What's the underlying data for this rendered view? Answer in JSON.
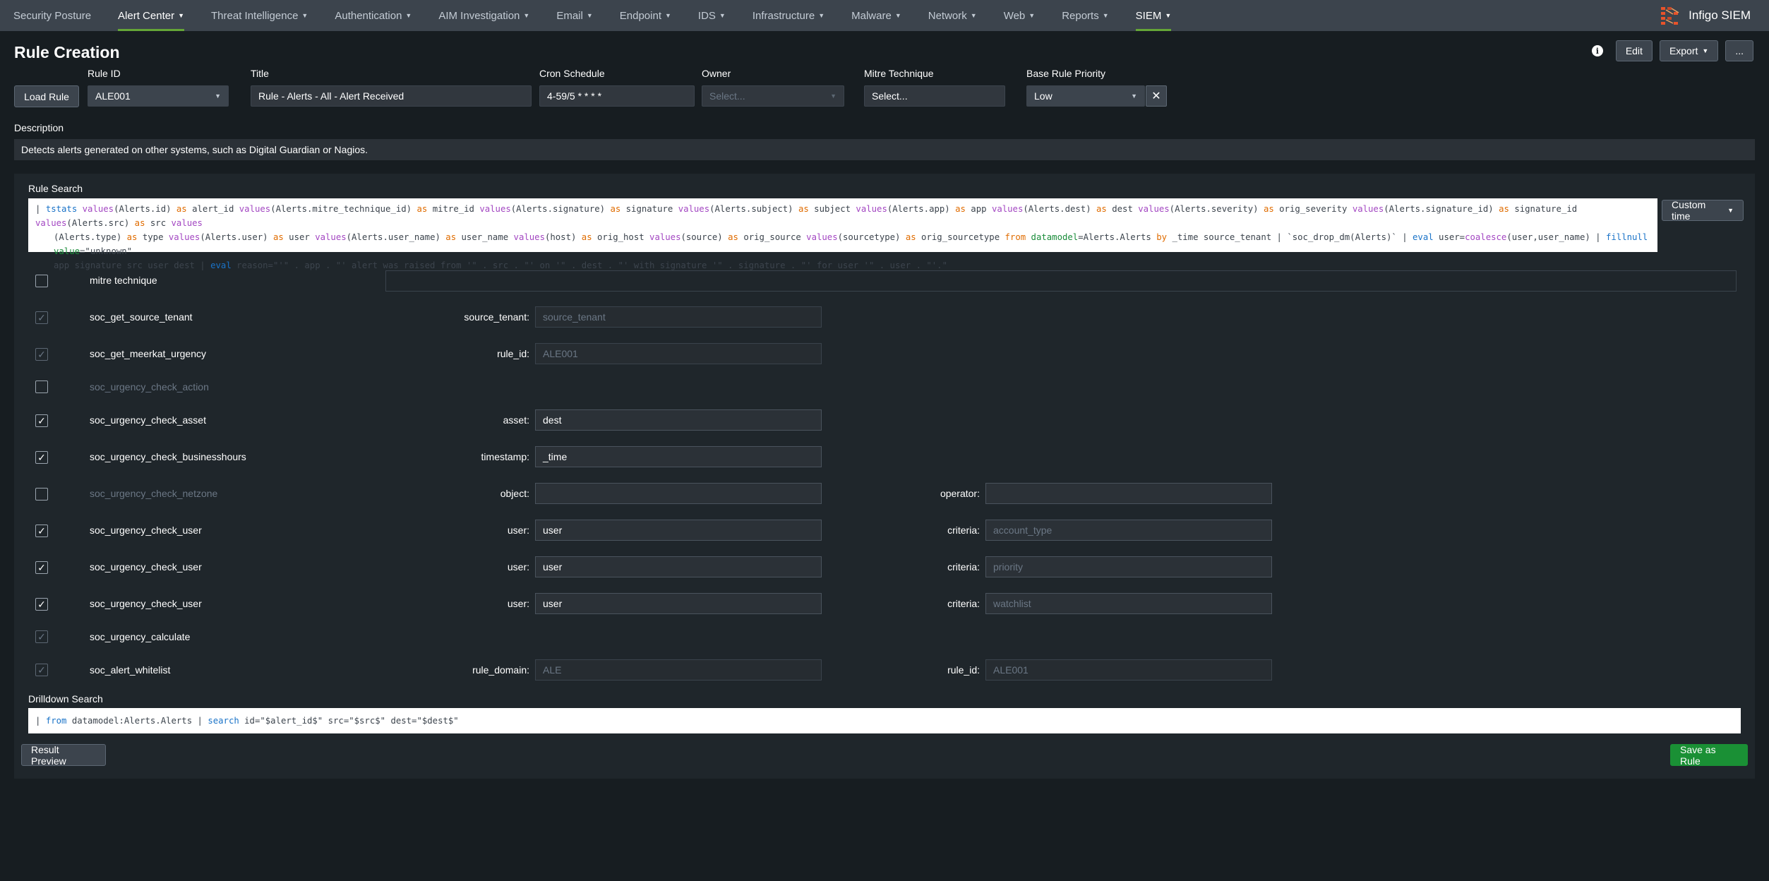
{
  "nav": {
    "items": [
      {
        "label": "Security Posture",
        "caret": false,
        "active": false
      },
      {
        "label": "Alert Center",
        "caret": true,
        "active": true
      },
      {
        "label": "Threat Intelligence",
        "caret": true,
        "active": false
      },
      {
        "label": "Authentication",
        "caret": true,
        "active": false
      },
      {
        "label": "AIM Investigation",
        "caret": true,
        "active": false
      },
      {
        "label": "Email",
        "caret": true,
        "active": false
      },
      {
        "label": "Endpoint",
        "caret": true,
        "active": false
      },
      {
        "label": "IDS",
        "caret": true,
        "active": false
      },
      {
        "label": "Infrastructure",
        "caret": true,
        "active": false
      },
      {
        "label": "Malware",
        "caret": true,
        "active": false
      },
      {
        "label": "Network",
        "caret": true,
        "active": false
      },
      {
        "label": "Web",
        "caret": true,
        "active": false
      },
      {
        "label": "Reports",
        "caret": true,
        "active": false
      },
      {
        "label": "SIEM",
        "caret": true,
        "active": true
      }
    ],
    "brand": "Infigo SIEM",
    "accent": "#65a637"
  },
  "page": {
    "title": "Rule Creation",
    "edit_label": "Edit",
    "export_label": "Export",
    "more_label": "..."
  },
  "form": {
    "load_rule_label": "Load Rule",
    "rule_id_label": "Rule ID",
    "rule_id_value": "ALE001",
    "title_label": "Title",
    "title_value": "Rule - Alerts - All - Alert Received",
    "cron_label": "Cron Schedule",
    "cron_value": "4-59/5 * * * *",
    "owner_label": "Owner",
    "owner_placeholder": "Select...",
    "mitre_label": "Mitre Technique",
    "mitre_placeholder": "Select...",
    "priority_label": "Base Rule Priority",
    "priority_value": "Low",
    "description_label": "Description",
    "description_value": "Detects alerts generated on other systems, such as Digital Guardian or Nagios."
  },
  "rule_search": {
    "label": "Rule Search",
    "custom_time_label": "Custom time"
  },
  "rows": [
    {
      "name": "mitre technique",
      "checked": false,
      "disabled": false,
      "muted": false
    },
    {
      "name": "soc_get_source_tenant",
      "checked": true,
      "disabled": true,
      "muted": false,
      "p1_label": "source_tenant:",
      "p1_value": "source_tenant"
    },
    {
      "name": "soc_get_meerkat_urgency",
      "checked": true,
      "disabled": true,
      "muted": false,
      "p1_label": "rule_id:",
      "p1_value": "ALE001"
    },
    {
      "name": "soc_urgency_check_action",
      "checked": false,
      "disabled": false,
      "muted": true
    },
    {
      "name": "soc_urgency_check_asset",
      "checked": true,
      "disabled": false,
      "muted": false,
      "p1_label": "asset:",
      "p1_value": "dest"
    },
    {
      "name": "soc_urgency_check_businesshours",
      "checked": true,
      "disabled": false,
      "muted": false,
      "p1_label": "timestamp:",
      "p1_value": "_time"
    },
    {
      "name": "soc_urgency_check_netzone",
      "checked": false,
      "disabled": false,
      "muted": true,
      "p1_label": "object:",
      "p1_value": "",
      "p2_label": "operator:",
      "p2_value": ""
    },
    {
      "name": "soc_urgency_check_user",
      "checked": true,
      "disabled": false,
      "muted": false,
      "p1_label": "user:",
      "p1_value": "user",
      "p2_label": "criteria:",
      "p2_value": "account_type"
    },
    {
      "name": "soc_urgency_check_user",
      "checked": true,
      "disabled": false,
      "muted": false,
      "p1_label": "user:",
      "p1_value": "user",
      "p2_label": "criteria:",
      "p2_value": "priority"
    },
    {
      "name": "soc_urgency_check_user",
      "checked": true,
      "disabled": false,
      "muted": false,
      "p1_label": "user:",
      "p1_value": "user",
      "p2_label": "criteria:",
      "p2_value": "watchlist"
    },
    {
      "name": "soc_urgency_calculate",
      "checked": true,
      "disabled": true,
      "muted": false
    },
    {
      "name": "soc_alert_whitelist",
      "checked": true,
      "disabled": true,
      "muted": false,
      "p1_label": "rule_domain:",
      "p1_value": "ALE",
      "p2_label": "rule_id:",
      "p2_value": "ALE001"
    }
  ],
  "drilldown": {
    "label": "Drilldown Search"
  },
  "footer": {
    "result_preview_label": "Result Preview",
    "save_label": "Save as Rule"
  }
}
